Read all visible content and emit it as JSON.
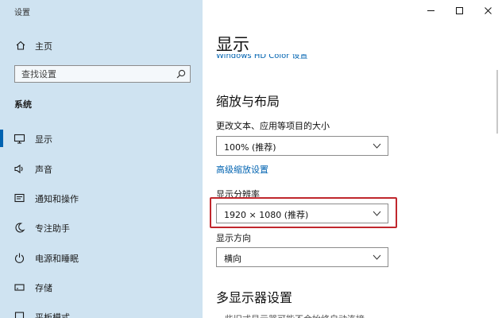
{
  "app": {
    "title": "设置"
  },
  "sidebar": {
    "home_label": "主页",
    "search_placeholder": "查找设置",
    "section_label": "系统",
    "items": [
      {
        "label": "显示",
        "icon": "monitor-icon",
        "active": true
      },
      {
        "label": "声音",
        "icon": "speaker-icon"
      },
      {
        "label": "通知和操作",
        "icon": "notification-icon"
      },
      {
        "label": "专注助手",
        "icon": "moon-icon"
      },
      {
        "label": "电源和睡眠",
        "icon": "power-icon"
      },
      {
        "label": "存储",
        "icon": "storage-icon"
      },
      {
        "label": "平板模式",
        "icon": "tablet-icon"
      }
    ]
  },
  "main": {
    "title": "显示",
    "hdr_link": "Windows HD Color 设置",
    "scale_heading": "缩放与布局",
    "scale_label": "更改文本、应用等项目的大小",
    "scale_value": "100% (推荐)",
    "advanced_link": "高级缩放设置",
    "resolution_label": "显示分辨率",
    "resolution_value": "1920 × 1080 (推荐)",
    "orientation_label": "显示方向",
    "orientation_value": "横向",
    "multi_heading": "多显示器设置",
    "bottom_text": "一些旧式显示器可能不会始终自动连接"
  },
  "colors": {
    "sidebar_bg": "#cfe3f1",
    "accent": "#0063b1",
    "highlight": "#c0272d"
  }
}
